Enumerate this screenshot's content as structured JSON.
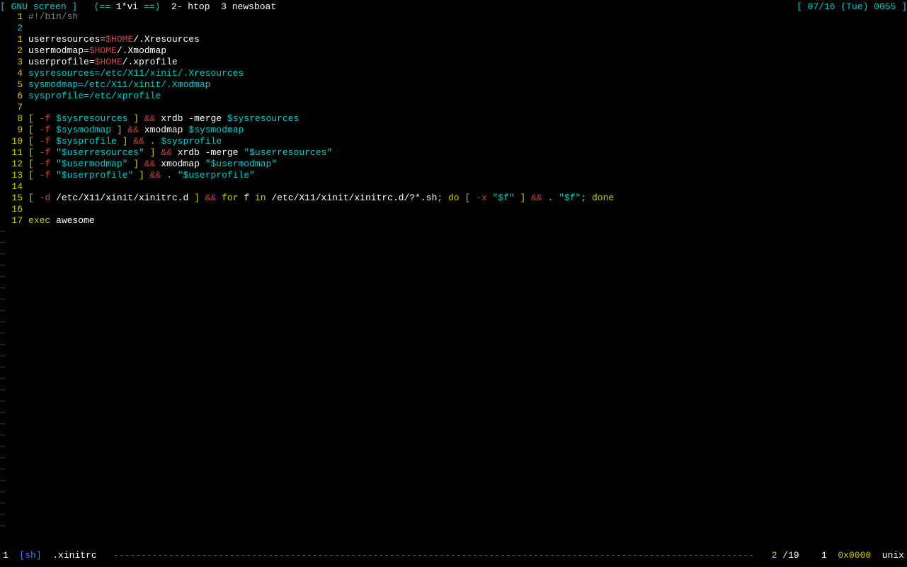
{
  "topbar": {
    "left_bracket": "[ ",
    "app": "GNU screen",
    "right_bracket": " ]",
    "sep": "   ",
    "active_l": "(== ",
    "active": "1*vi",
    "active_r": " ==)",
    "win2": "  2- htop",
    "win3": "  3 newsboat",
    "date": "[ 07/16 (Tue) 0055 ]"
  },
  "lines": {
    "l00": {
      "num": "1",
      "cur": false,
      "tokens": [
        {
          "c": "gr",
          "t": "#!/bin/sh"
        }
      ]
    },
    "l01": {
      "num": "2",
      "cur": true,
      "tokens": []
    },
    "l02": {
      "num": "1",
      "cur": false,
      "tokens": [
        {
          "c": "wh",
          "t": "userresources"
        },
        {
          "c": "wh",
          "t": "="
        },
        {
          "c": "re",
          "t": "$HOME"
        },
        {
          "c": "wh",
          "t": "/.Xresources"
        }
      ]
    },
    "l03": {
      "num": "2",
      "cur": false,
      "tokens": [
        {
          "c": "wh",
          "t": "usermodmap"
        },
        {
          "c": "wh",
          "t": "="
        },
        {
          "c": "re",
          "t": "$HOME"
        },
        {
          "c": "wh",
          "t": "/.Xmodmap"
        }
      ]
    },
    "l04": {
      "num": "3",
      "cur": false,
      "tokens": [
        {
          "c": "wh",
          "t": "userprofile"
        },
        {
          "c": "wh",
          "t": "="
        },
        {
          "c": "re",
          "t": "$HOME"
        },
        {
          "c": "wh",
          "t": "/.xprofile"
        }
      ]
    },
    "l05": {
      "num": "4",
      "cur": false,
      "tokens": [
        {
          "c": "cy",
          "t": "sysresources"
        },
        {
          "c": "cy",
          "t": "="
        },
        {
          "c": "cy",
          "t": "/etc/X11/xinit/.Xresources"
        }
      ]
    },
    "l06": {
      "num": "5",
      "cur": false,
      "tokens": [
        {
          "c": "cy",
          "t": "sysmodmap"
        },
        {
          "c": "cy",
          "t": "="
        },
        {
          "c": "cy",
          "t": "/etc/X11/xinit/.Xmodmap"
        }
      ]
    },
    "l07": {
      "num": "6",
      "cur": false,
      "tokens": [
        {
          "c": "cy",
          "t": "sysprofile"
        },
        {
          "c": "cy",
          "t": "="
        },
        {
          "c": "cy",
          "t": "/etc/xprofile"
        }
      ]
    },
    "l08": {
      "num": "7",
      "cur": false,
      "tokens": []
    },
    "l09": {
      "num": "8",
      "cur": false,
      "tokens": [
        {
          "c": "ye",
          "t": "[ "
        },
        {
          "c": "re",
          "t": "-f"
        },
        {
          "c": "wh",
          "t": " "
        },
        {
          "c": "cy",
          "t": "$sysresources"
        },
        {
          "c": "ye",
          "t": " ]"
        },
        {
          "c": "wh",
          "t": " "
        },
        {
          "c": "re",
          "t": "&&"
        },
        {
          "c": "wh",
          "t": " xrdb -merge "
        },
        {
          "c": "cy",
          "t": "$sysresources"
        }
      ]
    },
    "l10": {
      "num": "9",
      "cur": false,
      "tokens": [
        {
          "c": "ye",
          "t": "[ "
        },
        {
          "c": "re",
          "t": "-f"
        },
        {
          "c": "wh",
          "t": " "
        },
        {
          "c": "cy",
          "t": "$sysmodmap"
        },
        {
          "c": "ye",
          "t": " ]"
        },
        {
          "c": "wh",
          "t": " "
        },
        {
          "c": "re",
          "t": "&&"
        },
        {
          "c": "wh",
          "t": " xmodmap "
        },
        {
          "c": "cy",
          "t": "$sysmodmap"
        }
      ]
    },
    "l11": {
      "num": "10",
      "cur": false,
      "tokens": [
        {
          "c": "ye",
          "t": "[ "
        },
        {
          "c": "re",
          "t": "-f"
        },
        {
          "c": "wh",
          "t": " "
        },
        {
          "c": "cy",
          "t": "$sysprofile"
        },
        {
          "c": "ye",
          "t": " ]"
        },
        {
          "c": "wh",
          "t": " "
        },
        {
          "c": "re",
          "t": "&&"
        },
        {
          "c": "wh",
          "t": " "
        },
        {
          "c": "ye",
          "t": "."
        },
        {
          "c": "wh",
          "t": " "
        },
        {
          "c": "cy",
          "t": "$sysprofile"
        }
      ]
    },
    "l12": {
      "num": "11",
      "cur": false,
      "tokens": [
        {
          "c": "ye",
          "t": "[ "
        },
        {
          "c": "re",
          "t": "-f"
        },
        {
          "c": "wh",
          "t": " "
        },
        {
          "c": "cy",
          "t": "\"$userresources\""
        },
        {
          "c": "ye",
          "t": " ]"
        },
        {
          "c": "wh",
          "t": " "
        },
        {
          "c": "re",
          "t": "&&"
        },
        {
          "c": "wh",
          "t": " xrdb -merge "
        },
        {
          "c": "cy",
          "t": "\"$userresources\""
        }
      ]
    },
    "l13": {
      "num": "12",
      "cur": false,
      "tokens": [
        {
          "c": "ye",
          "t": "[ "
        },
        {
          "c": "re",
          "t": "-f"
        },
        {
          "c": "wh",
          "t": " "
        },
        {
          "c": "cy",
          "t": "\"$usermodmap\""
        },
        {
          "c": "ye",
          "t": " ]"
        },
        {
          "c": "wh",
          "t": " "
        },
        {
          "c": "re",
          "t": "&&"
        },
        {
          "c": "wh",
          "t": " xmodmap "
        },
        {
          "c": "cy",
          "t": "\"$usermodmap\""
        }
      ]
    },
    "l14": {
      "num": "13",
      "cur": false,
      "tokens": [
        {
          "c": "ye",
          "t": "[ "
        },
        {
          "c": "re",
          "t": "-f"
        },
        {
          "c": "wh",
          "t": " "
        },
        {
          "c": "cy",
          "t": "\"$userprofile\""
        },
        {
          "c": "ye",
          "t": " ]"
        },
        {
          "c": "wh",
          "t": " "
        },
        {
          "c": "re",
          "t": "&&"
        },
        {
          "c": "wh",
          "t": " "
        },
        {
          "c": "ye",
          "t": "."
        },
        {
          "c": "wh",
          "t": " "
        },
        {
          "c": "cy",
          "t": "\"$userprofile\""
        }
      ]
    },
    "l15": {
      "num": "14",
      "cur": false,
      "tokens": []
    },
    "l16": {
      "num": "15",
      "cur": false,
      "tokens": [
        {
          "c": "ye",
          "t": "[ "
        },
        {
          "c": "re",
          "t": "-d"
        },
        {
          "c": "wh",
          "t": " /etc/X11/xinit/xinitrc.d "
        },
        {
          "c": "ye",
          "t": "]"
        },
        {
          "c": "wh",
          "t": " "
        },
        {
          "c": "re",
          "t": "&&"
        },
        {
          "c": "wh",
          "t": " "
        },
        {
          "c": "ye",
          "t": "for"
        },
        {
          "c": "wh",
          "t": " f "
        },
        {
          "c": "ye",
          "t": "in"
        },
        {
          "c": "wh",
          "t": " /etc/X11/xinit/xinitrc.d/?*.sh"
        },
        {
          "c": "ye",
          "t": ";"
        },
        {
          "c": "wh",
          "t": " "
        },
        {
          "c": "ye",
          "t": "do"
        },
        {
          "c": "wh",
          "t": " "
        },
        {
          "c": "ye",
          "t": "[ "
        },
        {
          "c": "re",
          "t": "-x"
        },
        {
          "c": "wh",
          "t": " "
        },
        {
          "c": "cy",
          "t": "\"$f\""
        },
        {
          "c": "ye",
          "t": " ]"
        },
        {
          "c": "wh",
          "t": " "
        },
        {
          "c": "re",
          "t": "&&"
        },
        {
          "c": "wh",
          "t": " "
        },
        {
          "c": "ye",
          "t": "."
        },
        {
          "c": "wh",
          "t": " "
        },
        {
          "c": "cy",
          "t": "\"$f\""
        },
        {
          "c": "ye",
          "t": ";"
        },
        {
          "c": "wh",
          "t": " "
        },
        {
          "c": "ye",
          "t": "done"
        }
      ]
    },
    "l17": {
      "num": "16",
      "cur": false,
      "tokens": []
    },
    "l18": {
      "num": "17",
      "cur": false,
      "tokens": [
        {
          "c": "ye",
          "t": "exec"
        },
        {
          "c": "wh",
          "t": " awesome"
        }
      ]
    }
  },
  "tilde_count": 27,
  "tilde_char": "~",
  "status": {
    "bufnum": "1",
    "lbracket": "  [",
    "filetype": "sh",
    "rbracket": "]",
    "filename": "  .xinitrc   ",
    "dash": "-",
    "line": "2",
    "slash": " /",
    "total": "19",
    "col": "1",
    "hex": "0x0000",
    "ff": "unix"
  }
}
